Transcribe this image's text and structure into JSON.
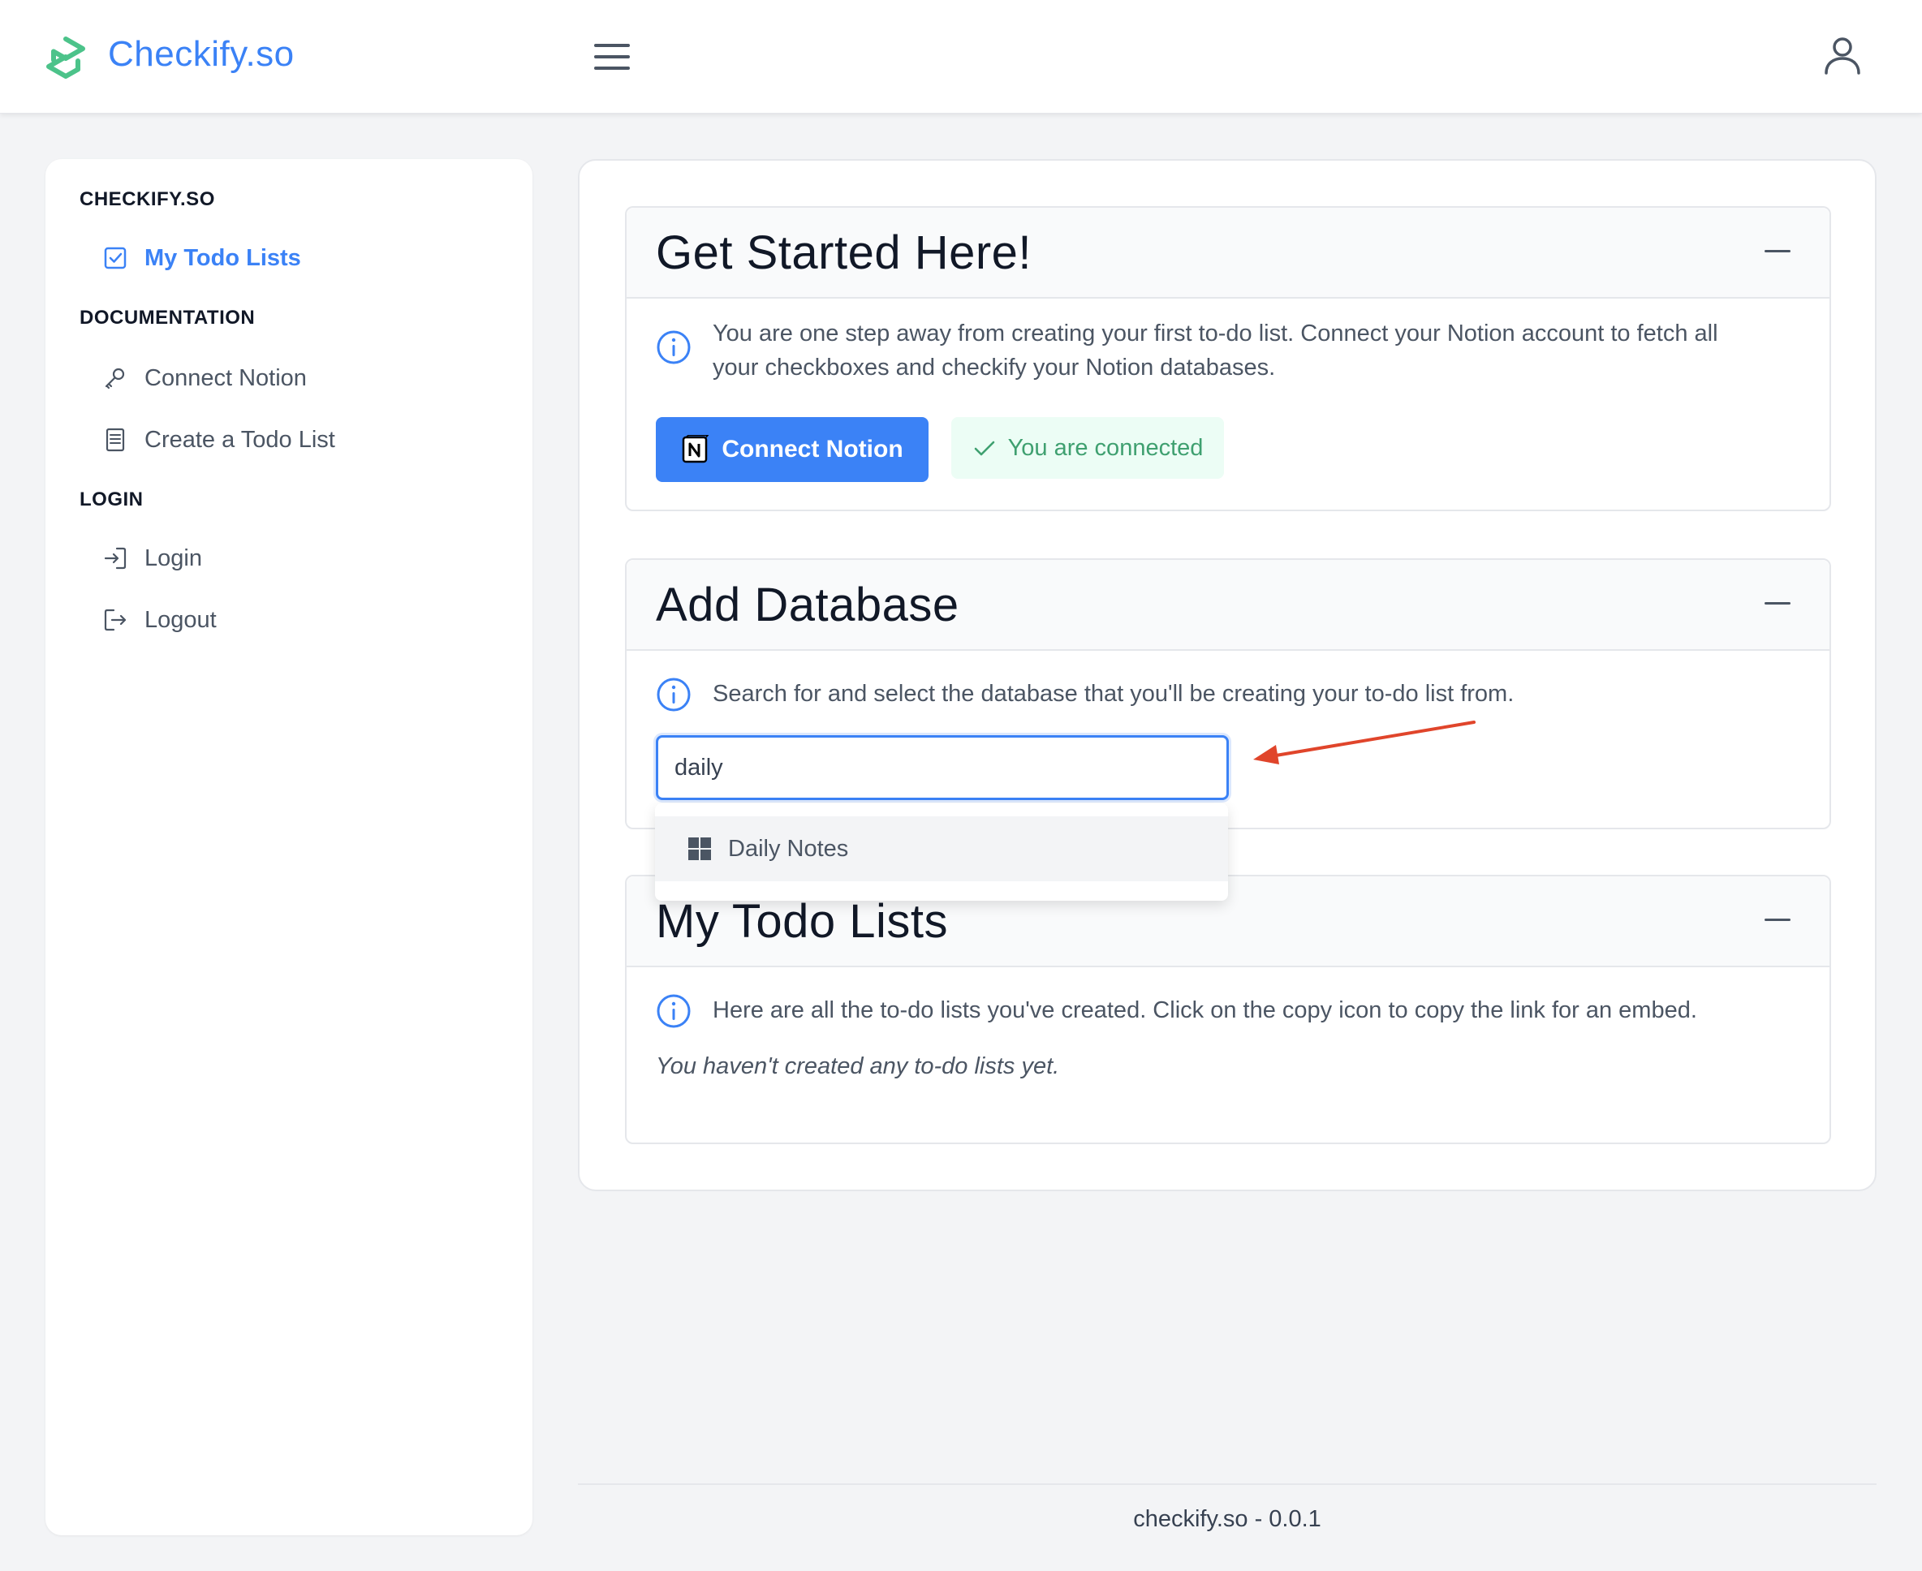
{
  "header": {
    "app_title": "Checkify.so",
    "logo_icon": "checkify-logo-icon",
    "menu_icon": "hamburger-menu-icon",
    "user_icon": "user-profile-icon"
  },
  "sidebar": {
    "sections": [
      {
        "heading": "CHECKIFY.SO",
        "items": [
          {
            "label": "My Todo Lists",
            "icon": "check-square-icon",
            "active": true
          }
        ]
      },
      {
        "heading": "DOCUMENTATION",
        "items": [
          {
            "label": "Connect Notion",
            "icon": "key-icon"
          },
          {
            "label": "Create a Todo List",
            "icon": "document-icon"
          }
        ]
      },
      {
        "heading": "LOGIN",
        "items": [
          {
            "label": "Login",
            "icon": "login-icon"
          },
          {
            "label": "Logout",
            "icon": "logout-icon"
          }
        ]
      }
    ]
  },
  "get_started": {
    "title": "Get Started Here!",
    "info_line1": "You are one step away from creating your first to-do list. Connect your Notion account to fetch all",
    "info_line2": "your checkboxes and checkify your Notion databases.",
    "connect_button": "Connect Notion",
    "connected_status": "You are connected"
  },
  "add_database": {
    "title": "Add Database",
    "info": "Search for and select the database that you'll be creating your to-do list from.",
    "search_value": "daily",
    "dropdown_option": "Daily Notes"
  },
  "my_todo_lists": {
    "title": "My Todo Lists",
    "info": "Here are all the to-do lists you've created. Click on the copy icon to copy the link for an embed.",
    "empty_message": "You haven't created any to-do lists yet."
  },
  "footer": {
    "text": "checkify.so - 0.0.1"
  },
  "colors": {
    "accent": "#3b82f6",
    "success": "#3fa070",
    "success_bg": "#ecfdf5",
    "annotation_arrow": "#e0452b",
    "logo": "#4cc38a"
  }
}
